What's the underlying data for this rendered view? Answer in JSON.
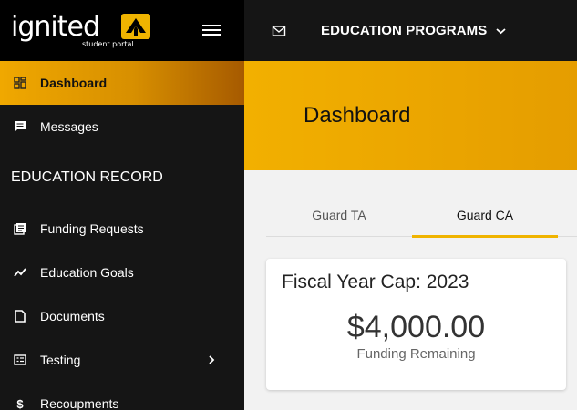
{
  "brand": {
    "logo_text": "ignited",
    "logo_sub": "student portal",
    "accent": "#f0b400"
  },
  "header": {
    "program_title": "EDUCATION PROGRAMS"
  },
  "sidebar": {
    "items_top": [
      {
        "label": "Dashboard",
        "icon": "dashboard-icon",
        "active": true
      },
      {
        "label": "Messages",
        "icon": "message-icon",
        "active": false
      }
    ],
    "section_title": "EDUCATION RECORD",
    "items_record": [
      {
        "label": "Funding Requests",
        "icon": "funding-requests-icon"
      },
      {
        "label": "Education Goals",
        "icon": "trend-icon"
      },
      {
        "label": "Documents",
        "icon": "document-icon"
      },
      {
        "label": "Testing",
        "icon": "testing-icon",
        "has_children": true
      },
      {
        "label": "Recoupments",
        "icon": "dollar-icon"
      }
    ]
  },
  "page": {
    "title": "Dashboard"
  },
  "tabs": [
    {
      "label": "Guard TA",
      "active": false
    },
    {
      "label": "Guard CA",
      "active": true
    }
  ],
  "card": {
    "title": "Fiscal Year Cap: 2023",
    "amount": "$4,000.00",
    "amount_label": "Funding Remaining"
  }
}
